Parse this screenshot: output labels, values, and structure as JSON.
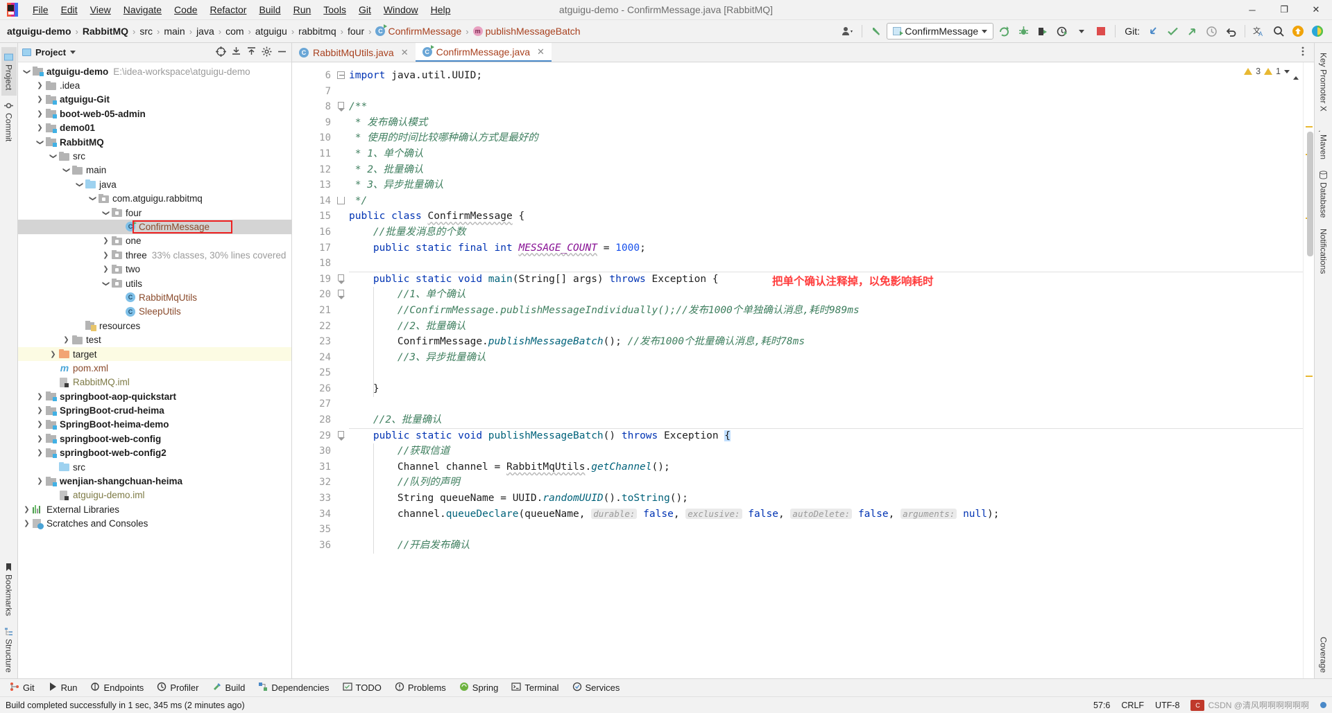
{
  "window": {
    "title": "atguigu-demo - ConfirmMessage.java [RabbitMQ]",
    "minimize": "─",
    "maximize": "❐",
    "close": "✕"
  },
  "menubar": {
    "items": [
      "File",
      "Edit",
      "View",
      "Navigate",
      "Code",
      "Refactor",
      "Build",
      "Run",
      "Tools",
      "Git",
      "Window",
      "Help"
    ]
  },
  "breadcrumbs": [
    {
      "label": "atguigu-demo",
      "style": "bold"
    },
    {
      "label": "RabbitMQ",
      "style": "bold"
    },
    {
      "label": "src",
      "style": "plain"
    },
    {
      "label": "main",
      "style": "plain"
    },
    {
      "label": "java",
      "style": "plain"
    },
    {
      "label": "com",
      "style": "plain"
    },
    {
      "label": "atguigu",
      "style": "plain"
    },
    {
      "label": "rabbitmq",
      "style": "plain"
    },
    {
      "label": "four",
      "style": "plain"
    },
    {
      "label": "ConfirmMessage",
      "style": "class"
    },
    {
      "label": "publishMessageBatch",
      "style": "method"
    }
  ],
  "toolbar": {
    "run_config": "ConfirmMessage",
    "git_label": "Git:",
    "icons": [
      "avatar-icon",
      "back-arrow-icon",
      "rerun-icon",
      "debug-icon",
      "run-with-coverage-icon",
      "profiler-icon",
      "stop-icon",
      "git-update-icon",
      "git-commit-icon",
      "git-push-icon",
      "git-history-icon",
      "git-rollback-icon",
      "translate-icon",
      "search-everywhere-icon",
      "upload-icon",
      "ide-eye-icon"
    ]
  },
  "left_rail": [
    {
      "label": "Project",
      "name": "project",
      "active": true
    },
    {
      "label": "Commit",
      "name": "commit",
      "active": false
    },
    {
      "label": "Bookmarks",
      "name": "bookmarks",
      "active": false
    },
    {
      "label": "Structure",
      "name": "structure",
      "active": false
    }
  ],
  "right_rail": [
    {
      "label": "Key Promoter X",
      "name": "key-promoter-x"
    },
    {
      "label": "Maven",
      "name": "maven"
    },
    {
      "label": "Database",
      "name": "database"
    },
    {
      "label": "Notifications",
      "name": "notifications"
    },
    {
      "label": "Coverage",
      "name": "coverage"
    }
  ],
  "project_panel": {
    "title": "Project",
    "header_icons": [
      "target-icon",
      "expand-all-icon",
      "collapse-all-icon",
      "settings-icon",
      "hide-icon"
    ],
    "tree": [
      {
        "depth": 0,
        "arrow": "down",
        "icon": "module-folder",
        "label": "atguigu-demo",
        "bold": true,
        "suffix": "E:\\idea-workspace\\atguigu-demo"
      },
      {
        "depth": 1,
        "arrow": "right",
        "icon": "folder",
        "label": ".idea",
        "bold": false,
        "suffix": ""
      },
      {
        "depth": 1,
        "arrow": "right",
        "icon": "module-folder",
        "label": "atguigu-Git",
        "bold": true,
        "suffix": ""
      },
      {
        "depth": 1,
        "arrow": "right",
        "icon": "module-folder",
        "label": "boot-web-05-admin",
        "bold": true,
        "suffix": ""
      },
      {
        "depth": 1,
        "arrow": "right",
        "icon": "module-folder",
        "label": "demo01",
        "bold": true,
        "suffix": ""
      },
      {
        "depth": 1,
        "arrow": "down",
        "icon": "module-folder",
        "label": "RabbitMQ",
        "bold": true,
        "suffix": ""
      },
      {
        "depth": 2,
        "arrow": "down",
        "icon": "folder",
        "label": "src",
        "bold": false,
        "suffix": ""
      },
      {
        "depth": 3,
        "arrow": "down",
        "icon": "folder",
        "label": "main",
        "bold": false,
        "suffix": ""
      },
      {
        "depth": 4,
        "arrow": "down",
        "icon": "source-folder",
        "label": "java",
        "bold": false,
        "suffix": ""
      },
      {
        "depth": 5,
        "arrow": "down",
        "icon": "package",
        "label": "com.atguigu.rabbitmq",
        "bold": false,
        "suffix": ""
      },
      {
        "depth": 6,
        "arrow": "down",
        "icon": "package",
        "label": "four",
        "bold": false,
        "suffix": ""
      },
      {
        "depth": 7,
        "arrow": "none",
        "icon": "class-runnable",
        "label": "ConfirmMessage",
        "bold": false,
        "suffix": "",
        "selected": true,
        "highlight_box": true,
        "brown": true
      },
      {
        "depth": 6,
        "arrow": "right",
        "icon": "package",
        "label": "one",
        "bold": false,
        "suffix": ""
      },
      {
        "depth": 6,
        "arrow": "right",
        "icon": "package",
        "label": "three",
        "bold": false,
        "suffix": "33% classes, 30% lines covered"
      },
      {
        "depth": 6,
        "arrow": "right",
        "icon": "package",
        "label": "two",
        "bold": false,
        "suffix": ""
      },
      {
        "depth": 6,
        "arrow": "down",
        "icon": "package",
        "label": "utils",
        "bold": false,
        "suffix": ""
      },
      {
        "depth": 7,
        "arrow": "none",
        "icon": "class",
        "label": "RabbitMqUtils",
        "bold": false,
        "suffix": "",
        "brown": true
      },
      {
        "depth": 7,
        "arrow": "none",
        "icon": "class",
        "label": "SleepUtils",
        "bold": false,
        "suffix": "",
        "brown": true
      },
      {
        "depth": 4,
        "arrow": "none",
        "icon": "resources",
        "label": "resources",
        "bold": false,
        "suffix": ""
      },
      {
        "depth": 3,
        "arrow": "right",
        "icon": "folder",
        "label": "test",
        "bold": false,
        "suffix": ""
      },
      {
        "depth": 2,
        "arrow": "right",
        "icon": "target-folder",
        "label": "target",
        "bold": false,
        "suffix": "",
        "yellow": true
      },
      {
        "depth": 2,
        "arrow": "none",
        "icon": "maven",
        "label": "pom.xml",
        "bold": false,
        "suffix": "",
        "brown": true
      },
      {
        "depth": 2,
        "arrow": "none",
        "icon": "iml",
        "label": "RabbitMQ.iml",
        "bold": false,
        "suffix": "",
        "olive": true
      },
      {
        "depth": 1,
        "arrow": "right",
        "icon": "module-folder",
        "label": "springboot-aop-quickstart",
        "bold": true,
        "suffix": ""
      },
      {
        "depth": 1,
        "arrow": "right",
        "icon": "module-folder",
        "label": "SpringBoot-crud-heima",
        "bold": true,
        "suffix": ""
      },
      {
        "depth": 1,
        "arrow": "right",
        "icon": "module-folder",
        "label": "SpringBoot-heima-demo",
        "bold": true,
        "suffix": ""
      },
      {
        "depth": 1,
        "arrow": "right",
        "icon": "module-folder",
        "label": "springboot-web-config",
        "bold": true,
        "suffix": ""
      },
      {
        "depth": 1,
        "arrow": "right",
        "icon": "module-folder",
        "label": "springboot-web-config2",
        "bold": true,
        "suffix": ""
      },
      {
        "depth": 2,
        "arrow": "none",
        "icon": "source-folder",
        "label": "src",
        "bold": false,
        "suffix": ""
      },
      {
        "depth": 1,
        "arrow": "right",
        "icon": "module-folder",
        "label": "wenjian-shangchuan-heima",
        "bold": true,
        "suffix": ""
      },
      {
        "depth": 2,
        "arrow": "none",
        "icon": "iml",
        "label": "atguigu-demo.iml",
        "bold": false,
        "suffix": "",
        "olive": true
      },
      {
        "depth": 0,
        "arrow": "right",
        "icon": "ext-libs",
        "label": "External Libraries",
        "bold": false,
        "suffix": ""
      },
      {
        "depth": 0,
        "arrow": "right",
        "icon": "scratches",
        "label": "Scratches and Consoles",
        "bold": false,
        "suffix": ""
      }
    ]
  },
  "editor": {
    "tabs": [
      {
        "label": "RabbitMqUtils.java",
        "icon": "class-icon",
        "active": false
      },
      {
        "label": "ConfirmMessage.java",
        "icon": "class-runnable-icon",
        "active": true
      }
    ],
    "inspection": {
      "warnings": "3",
      "weak_warnings": "1"
    },
    "first_line_number": 6,
    "lines": [
      {
        "n": 6,
        "runmark": false,
        "fold": "minus",
        "html": "<span class=\"kw\">import</span> java.util.UUID;"
      },
      {
        "n": 7,
        "runmark": false,
        "fold": "",
        "html": ""
      },
      {
        "n": 8,
        "runmark": false,
        "fold": "arrow",
        "html": "<span class=\"cm\">/**</span>"
      },
      {
        "n": 9,
        "runmark": false,
        "fold": "",
        "html": " <span class=\"cm\">* 发布确认模式</span>"
      },
      {
        "n": 10,
        "runmark": false,
        "fold": "",
        "html": " <span class=\"cm\">* 使用的时间比较哪种确认方式是最好的</span>"
      },
      {
        "n": 11,
        "runmark": false,
        "fold": "",
        "html": " <span class=\"cm\">* 1、单个确认</span>"
      },
      {
        "n": 12,
        "runmark": false,
        "fold": "",
        "html": " <span class=\"cm\">* 2、批量确认</span>"
      },
      {
        "n": 13,
        "runmark": false,
        "fold": "",
        "html": " <span class=\"cm\">* 3、异步批量确认</span>"
      },
      {
        "n": 14,
        "runmark": false,
        "fold": "end",
        "html": " <span class=\"cm\">*/</span>"
      },
      {
        "n": 15,
        "runmark": true,
        "fold": "",
        "html": "<span class=\"kw\">public class</span> <span class=\"wavy\">ConfirmMessage</span> {"
      },
      {
        "n": 16,
        "runmark": false,
        "fold": "",
        "html": "    <span class=\"cm\">//批量发消息的个数</span>"
      },
      {
        "n": 17,
        "runmark": false,
        "fold": "",
        "html": "    <span class=\"kw\">public static final</span> <span class=\"kw\">int</span> <span class=\"fld wavy\">MESSAGE_COUNT</span> = <span class=\"num\">1000</span>;"
      },
      {
        "n": 18,
        "runmark": false,
        "fold": "",
        "html": ""
      },
      {
        "n": 19,
        "runmark": true,
        "fold": "arrow",
        "html": "    <span class=\"kw\">public static void</span> <span class=\"mth\">main</span>(String[] args) <span class=\"kw\">throws</span> Exception {"
      },
      {
        "n": 20,
        "runmark": false,
        "fold": "arrow",
        "html": "        <span class=\"cm\">//1、单个确认</span>"
      },
      {
        "n": 21,
        "runmark": false,
        "fold": "",
        "html": "        <span class=\"cm\">//ConfirmMessage.publishMessageIndividually();//发布1000个单独确认消息,耗时989ms</span>"
      },
      {
        "n": 22,
        "runmark": false,
        "fold": "",
        "html": "        <span class=\"cm\">//2、批量确认</span>"
      },
      {
        "n": 23,
        "runmark": false,
        "fold": "",
        "html": "        ConfirmMessage.<span class=\"mthi\">publishMessageBatch</span>(); <span class=\"cm\">//发布1000个批量确认消息,耗时78ms</span>"
      },
      {
        "n": 24,
        "runmark": false,
        "fold": "",
        "html": "        <span class=\"cm\">//3、异步批量确认</span>"
      },
      {
        "n": 25,
        "runmark": false,
        "fold": "",
        "html": ""
      },
      {
        "n": 26,
        "runmark": false,
        "fold": "",
        "html": "    }"
      },
      {
        "n": 27,
        "runmark": false,
        "fold": "",
        "html": ""
      },
      {
        "n": 28,
        "runmark": false,
        "fold": "",
        "html": "    <span class=\"cm\">//2、批量确认</span>"
      },
      {
        "n": 29,
        "runmark": false,
        "fold": "arrow",
        "html": "    <span class=\"kw\">public static void</span> <span class=\"mth\">publishMessageBatch</span>() <span class=\"kw\">throws</span> Exception <span style=\"background:#c0dfff\">{</span>"
      },
      {
        "n": 30,
        "runmark": false,
        "fold": "",
        "html": "        <span class=\"cm\">//获取信道</span>"
      },
      {
        "n": 31,
        "runmark": false,
        "fold": "",
        "html": "        Channel channel = <span class=\"wavy\">RabbitMqUtils</span>.<span class=\"mthi\">getChannel</span>();"
      },
      {
        "n": 32,
        "runmark": false,
        "fold": "",
        "html": "        <span class=\"cm\">//队列的声明</span>"
      },
      {
        "n": 33,
        "runmark": false,
        "fold": "",
        "html": "        String queueName = UUID.<span class=\"mthi\">randomUUID</span>().<span class=\"mth\">toString</span>();"
      },
      {
        "n": 34,
        "runmark": false,
        "fold": "",
        "html": "        channel.<span class=\"mth\">queueDeclare</span>(queueName, <span class=\"hint\">durable:</span> <span class=\"kw\">false</span>, <span class=\"hint\">exclusive:</span> <span class=\"kw\">false</span>, <span class=\"hint\">autoDelete:</span> <span class=\"kw\">false</span>, <span class=\"hint\">arguments:</span> <span class=\"kw\">null</span>);"
      },
      {
        "n": 35,
        "runmark": false,
        "fold": "",
        "html": ""
      },
      {
        "n": 36,
        "runmark": false,
        "fold": "",
        "html": "        <span class=\"cm\">//开启发布确认</span>"
      }
    ],
    "annotation": "把单个确认注释掉，以免影响耗时"
  },
  "bottom_bar": {
    "items": [
      {
        "label": "Git",
        "icon": "git-icon"
      },
      {
        "label": "Run",
        "icon": "run-icon"
      },
      {
        "label": "Endpoints",
        "icon": "endpoints-icon"
      },
      {
        "label": "Profiler",
        "icon": "profiler-icon"
      },
      {
        "label": "Build",
        "icon": "build-icon"
      },
      {
        "label": "Dependencies",
        "icon": "dependencies-icon"
      },
      {
        "label": "TODO",
        "icon": "todo-icon"
      },
      {
        "label": "Problems",
        "icon": "problems-icon"
      },
      {
        "label": "Spring",
        "icon": "spring-icon"
      },
      {
        "label": "Terminal",
        "icon": "terminal-icon"
      },
      {
        "label": "Services",
        "icon": "services-icon"
      }
    ]
  },
  "status_bar": {
    "message": "Build completed successfully in 1 sec, 345 ms (2 minutes ago)",
    "caret": "57:6",
    "line_separator": "CRLF",
    "encoding": "UTF-8",
    "watermark": "CSDN @清风啊啊啊啊啊啊"
  }
}
